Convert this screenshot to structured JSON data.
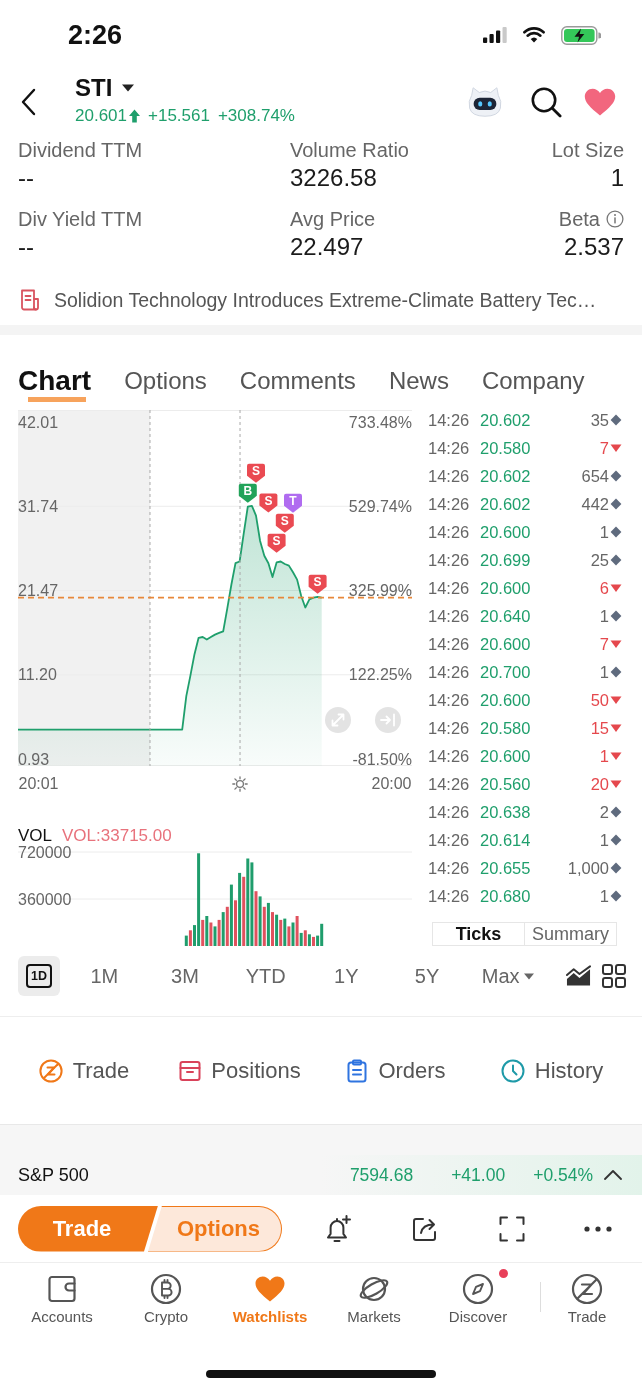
{
  "status_bar": {
    "time": "2:26"
  },
  "header": {
    "symbol": "STI",
    "price": "20.601",
    "change": "+15.561",
    "change_pct": "+308.74%"
  },
  "stats": [
    {
      "label": "Dividend TTM",
      "value": "--",
      "info": false
    },
    {
      "label": "Volume Ratio",
      "value": "3226.58",
      "info": false
    },
    {
      "label": "Lot Size",
      "value": "1",
      "info": false
    },
    {
      "label": "Div Yield TTM",
      "value": "--",
      "info": false
    },
    {
      "label": "Avg Price",
      "value": "22.497",
      "info": false
    },
    {
      "label": "Beta",
      "value": "2.537",
      "info": true
    }
  ],
  "news": {
    "headline": "Solidion Technology Introduces Extreme-Climate Battery Tec…"
  },
  "tabs": [
    {
      "label": "Chart",
      "selected": true
    },
    {
      "label": "Options",
      "selected": false
    },
    {
      "label": "Comments",
      "selected": false
    },
    {
      "label": "News",
      "selected": false
    },
    {
      "label": "Company",
      "selected": false
    }
  ],
  "chart": {
    "percent_ticks": [
      "733.48%",
      "529.74%",
      "325.99%",
      "122.25%",
      "-81.50%"
    ],
    "trade_markers": [
      {
        "text": "B",
        "color": "#22a35a"
      },
      {
        "text": "S",
        "color": "#ea4a52"
      },
      {
        "text": "S",
        "color": "#ea4a52"
      },
      {
        "text": "S",
        "color": "#ea4a52"
      },
      {
        "text": "S",
        "color": "#ea4a52"
      },
      {
        "text": "T",
        "color": "#b06cf0"
      },
      {
        "text": "S",
        "color": "#ea4a52"
      }
    ],
    "chart_data": {
      "type": "area",
      "grid": true,
      "categories": [
        null,
        null,
        null,
        null,
        null,
        "20:01",
        null,
        null,
        null,
        null,
        null,
        null,
        null,
        null,
        null,
        null,
        null,
        null,
        null,
        null,
        null,
        null,
        null,
        null,
        null,
        null,
        null,
        null,
        null,
        null,
        null,
        null,
        null,
        null,
        null,
        null,
        null,
        null,
        null,
        null,
        null,
        null,
        null,
        null,
        null,
        null,
        null,
        null,
        null,
        null,
        null,
        null,
        null,
        null,
        null,
        null,
        null,
        null,
        null,
        null,
        null,
        null,
        null,
        null,
        null,
        null,
        null,
        null,
        null,
        null,
        null,
        null,
        null,
        null,
        null,
        null,
        null,
        null,
        null,
        null,
        null,
        null,
        null,
        null,
        null,
        null,
        null,
        null,
        null,
        null,
        null,
        "20:00",
        null,
        null,
        null,
        null,
        null
      ],
      "series": [
        {
          "color": "#1f9f6c",
          "values": [
            4.5,
            4.5,
            4.5,
            4.5,
            4.5,
            4.5,
            4.5,
            4.5,
            4.5,
            4.5,
            4.5,
            4.5,
            4.5,
            4.5,
            4.5,
            4.5,
            4.5,
            4.5,
            4.5,
            4.5,
            4.5,
            4.5,
            4.5,
            4.5,
            4.5,
            4.5,
            4.5,
            4.5,
            4.5,
            4.5,
            4.5,
            4.5,
            4.5,
            4.5,
            4.5,
            4.5,
            4.5,
            4.5,
            4.5,
            4.5,
            4.5,
            8.6,
            11.1,
            13.7,
            15.7,
            15.8,
            15.5,
            15.8,
            16.1,
            16.3,
            16.5,
            19.3,
            22.2,
            24.8,
            25.0,
            28.4,
            31.7,
            31.8,
            30.6,
            27.5,
            25.7,
            24.8,
            23.1,
            24.9,
            25.0,
            24.7,
            24.5,
            23.7,
            22.8,
            20.8,
            19.4,
            20.4,
            20.6,
            20.7,
            20.6,
            null,
            null,
            null,
            null,
            null,
            null,
            null,
            null,
            null,
            null,
            null,
            null,
            null,
            null,
            null,
            null,
            null,
            null,
            null,
            null,
            null,
            null
          ]
        }
      ],
      "ylim": [
        0.93,
        42.01
      ],
      "yticks": [
        {
          "value": 42.01,
          "label": "42.01"
        },
        {
          "value": 31.74,
          "label": "31.74"
        },
        {
          "value": 21.47,
          "label": "21.47"
        },
        {
          "value": 11.2,
          "label": "11.20"
        },
        {
          "value": 0.93,
          "label": "0.93"
        }
      ],
      "ref_lines": [
        {
          "axis": "y",
          "value": 20.6
        }
      ]
    }
  },
  "volume": {
    "title": "VOL",
    "reading": "VOL:33715.00",
    "chart_data": {
      "type": "bar",
      "grid": true,
      "categories": [
        null,
        null,
        null,
        null,
        null,
        null,
        null,
        null,
        null,
        null,
        null,
        null,
        null,
        null,
        null,
        null,
        null,
        null,
        null,
        null,
        null,
        null,
        null,
        null,
        null,
        null,
        null,
        null,
        null,
        null,
        null,
        null,
        null,
        null,
        null,
        null,
        null,
        null,
        null,
        null,
        null,
        null,
        null,
        null,
        null,
        null,
        null,
        null,
        null,
        null,
        null,
        null,
        null,
        null,
        null,
        null,
        null,
        null,
        null,
        null,
        null,
        null,
        null,
        null,
        null,
        null,
        null,
        null,
        null,
        null,
        null,
        null,
        null,
        null,
        null,
        null,
        null,
        null,
        null,
        null,
        null,
        null,
        null,
        null,
        null,
        null,
        null,
        null,
        null,
        null,
        null,
        null,
        null,
        null,
        null,
        null,
        null
      ],
      "series": [
        {
          "color": "#1f9d6c",
          "values": [
            null,
            null,
            null,
            null,
            null,
            null,
            null,
            null,
            null,
            null,
            null,
            null,
            null,
            null,
            null,
            null,
            null,
            null,
            null,
            null,
            null,
            null,
            null,
            null,
            null,
            null,
            null,
            null,
            null,
            null,
            null,
            null,
            null,
            null,
            null,
            null,
            null,
            null,
            null,
            null,
            null,
            80000,
            null,
            160000,
            710000,
            null,
            230000,
            null,
            150000,
            null,
            260000,
            null,
            470000,
            null,
            560000,
            null,
            670000,
            640000,
            null,
            380000,
            null,
            330000,
            null,
            240000,
            null,
            210000,
            null,
            180000,
            null,
            100000,
            null,
            90000,
            null,
            80000,
            170000,
            null,
            null,
            null,
            null,
            null,
            null,
            null,
            null,
            null,
            null,
            null,
            null,
            null,
            null,
            null,
            null,
            null,
            null,
            null,
            null,
            null,
            null
          ]
        },
        {
          "color": "#e0525e",
          "values": [
            null,
            null,
            null,
            null,
            null,
            null,
            null,
            null,
            null,
            null,
            null,
            null,
            null,
            null,
            null,
            null,
            null,
            null,
            null,
            null,
            null,
            null,
            null,
            null,
            null,
            null,
            null,
            null,
            null,
            null,
            null,
            null,
            null,
            null,
            null,
            null,
            null,
            null,
            null,
            null,
            null,
            null,
            120000,
            null,
            null,
            200000,
            null,
            180000,
            null,
            200000,
            null,
            300000,
            null,
            350000,
            null,
            530000,
            null,
            null,
            420000,
            null,
            300000,
            null,
            260000,
            null,
            200000,
            null,
            150000,
            null,
            230000,
            null,
            120000,
            null,
            70000,
            null,
            null,
            null,
            null,
            null,
            null,
            null,
            null,
            null,
            null,
            null,
            null,
            null,
            null,
            null,
            null,
            null,
            null,
            null,
            null,
            null,
            null,
            null,
            null
          ]
        }
      ],
      "ylim": [
        0,
        720000
      ],
      "yticks": [
        {
          "value": 720000,
          "label": "720000"
        },
        {
          "value": 360000,
          "label": "360000"
        }
      ]
    }
  },
  "ticks": {
    "rows": [
      {
        "time": "14:26",
        "price": "20.602",
        "volume": "35",
        "kind": "neutral"
      },
      {
        "time": "14:26",
        "price": "20.580",
        "volume": "7",
        "kind": "down"
      },
      {
        "time": "14:26",
        "price": "20.602",
        "volume": "654",
        "kind": "neutral"
      },
      {
        "time": "14:26",
        "price": "20.602",
        "volume": "442",
        "kind": "neutral"
      },
      {
        "time": "14:26",
        "price": "20.600",
        "volume": "1",
        "kind": "neutral"
      },
      {
        "time": "14:26",
        "price": "20.699",
        "volume": "25",
        "kind": "neutral"
      },
      {
        "time": "14:26",
        "price": "20.600",
        "volume": "6",
        "kind": "down"
      },
      {
        "time": "14:26",
        "price": "20.640",
        "volume": "1",
        "kind": "neutral"
      },
      {
        "time": "14:26",
        "price": "20.600",
        "volume": "7",
        "kind": "down"
      },
      {
        "time": "14:26",
        "price": "20.700",
        "volume": "1",
        "kind": "neutral"
      },
      {
        "time": "14:26",
        "price": "20.600",
        "volume": "50",
        "kind": "down"
      },
      {
        "time": "14:26",
        "price": "20.580",
        "volume": "15",
        "kind": "down"
      },
      {
        "time": "14:26",
        "price": "20.600",
        "volume": "1",
        "kind": "down"
      },
      {
        "time": "14:26",
        "price": "20.560",
        "volume": "20",
        "kind": "down"
      },
      {
        "time": "14:26",
        "price": "20.638",
        "volume": "2",
        "kind": "neutral"
      },
      {
        "time": "14:26",
        "price": "20.614",
        "volume": "1",
        "kind": "neutral"
      },
      {
        "time": "14:26",
        "price": "20.655",
        "volume": "1,000",
        "kind": "neutral"
      },
      {
        "time": "14:26",
        "price": "20.680",
        "volume": "1",
        "kind": "neutral"
      }
    ],
    "tabs": [
      {
        "label": "Ticks",
        "selected": true
      },
      {
        "label": "Summary",
        "selected": false
      }
    ]
  },
  "periods": [
    {
      "label": "1D",
      "selected": true,
      "dropdown": false
    },
    {
      "label": "1M",
      "selected": false,
      "dropdown": false
    },
    {
      "label": "3M",
      "selected": false,
      "dropdown": false
    },
    {
      "label": "YTD",
      "selected": false,
      "dropdown": false
    },
    {
      "label": "1Y",
      "selected": false,
      "dropdown": false
    },
    {
      "label": "5Y",
      "selected": false,
      "dropdown": false
    },
    {
      "label": "Max",
      "selected": false,
      "dropdown": true
    }
  ],
  "actions": [
    {
      "label": "Trade",
      "kind": "trade"
    },
    {
      "label": "Positions",
      "kind": "positions"
    },
    {
      "label": "Orders",
      "kind": "orders"
    },
    {
      "label": "History",
      "kind": "history"
    }
  ],
  "index_ticker": {
    "name": "S&P 500",
    "value": "7594.68",
    "change": "+41.00",
    "change_pct": "+0.54%"
  },
  "order_buttons": {
    "primary": "Trade",
    "secondary": "Options"
  },
  "tab_bar": [
    {
      "label": "Accounts",
      "kind": "wallet",
      "selected": false,
      "badge": false
    },
    {
      "label": "Crypto",
      "kind": "bitcoin",
      "selected": false,
      "badge": false
    },
    {
      "label": "Watchlists",
      "kind": "heart",
      "selected": true,
      "badge": false
    },
    {
      "label": "Markets",
      "kind": "planet",
      "selected": false,
      "badge": false
    },
    {
      "label": "Discover",
      "kind": "compass",
      "selected": false,
      "badge": true
    },
    {
      "label": "Trade",
      "kind": "trade",
      "selected": false,
      "badge": false
    }
  ]
}
